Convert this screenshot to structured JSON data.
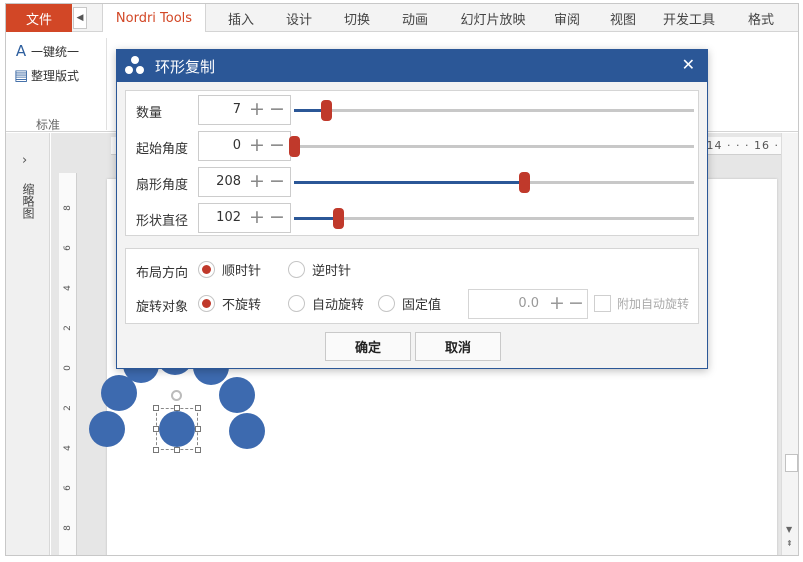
{
  "ribbon": {
    "file_tab": "文件",
    "tabs": [
      "Nordri Tools",
      "插入",
      "设计",
      "切换",
      "动画",
      "幻灯片放映",
      "审阅",
      "视图",
      "开发工具",
      "格式"
    ],
    "active_tab": "Nordri Tools",
    "items": [
      {
        "label": "一键统一",
        "icon": "text-a-icon"
      },
      {
        "label": "整理版式",
        "icon": "format-icon"
      }
    ],
    "group_label": "标准",
    "accent_color": "#d24726"
  },
  "left_pane": {
    "label": "缩略图",
    "expand_icon": "chevron-right-icon"
  },
  "ruler": {
    "horizontal_numbers": "14 · · · 16 ·",
    "vertical_ticks": [
      "8",
      "6",
      "4",
      "2",
      "0",
      "2",
      "4",
      "6",
      "8"
    ]
  },
  "dialog": {
    "title": "环形复制",
    "close": "✕",
    "title_color": "#2b5797",
    "sliders": [
      {
        "label": "数量",
        "value": "7",
        "fraction": 0.08
      },
      {
        "label": "起始角度",
        "value": "0",
        "fraction": 0.0
      },
      {
        "label": "扇形角度",
        "value": "208",
        "fraction": 0.575
      },
      {
        "label": "形状直径",
        "value": "102",
        "fraction": 0.11
      }
    ],
    "plus": "+",
    "minus": "−",
    "layout_direction": {
      "label": "布局方向",
      "options": [
        "顺时针",
        "逆时针"
      ],
      "selected": "顺时针"
    },
    "rotate_object": {
      "label": "旋转对象",
      "options": [
        "不旋转",
        "自动旋转",
        "固定值"
      ],
      "selected": "不旋转",
      "fixed_value": "0.0",
      "checkbox_label": "附加自动旋转"
    },
    "ok": "确定",
    "cancel": "取消",
    "knob_color": "#c0392b"
  },
  "canvas": {
    "shape_color": "#3d6aaf"
  }
}
